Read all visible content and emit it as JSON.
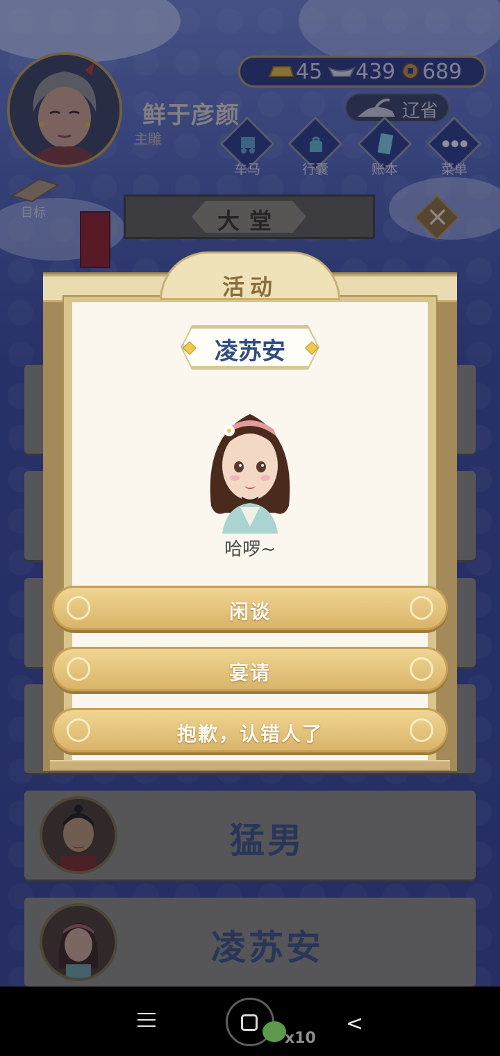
{
  "player": {
    "name": "鲜于彦颜",
    "title": "主雕"
  },
  "currencies": [
    {
      "icon": "gold-bar-icon",
      "value": "45"
    },
    {
      "icon": "silver-ingot-icon",
      "value": "439"
    },
    {
      "icon": "copper-coin-icon",
      "value": "689"
    }
  ],
  "region": {
    "label": "辽省",
    "icon": "iron-icon"
  },
  "menu": [
    {
      "label": "车马",
      "icon": "carriage-icon"
    },
    {
      "label": "行囊",
      "icon": "bag-icon"
    },
    {
      "label": "账本",
      "icon": "ledger-icon"
    },
    {
      "label": "菜单",
      "icon": "more-icon"
    }
  ],
  "goal": {
    "label": "目标",
    "icon": "scroll-icon"
  },
  "location": {
    "label": "大堂"
  },
  "list": [
    {
      "name": "猛男"
    },
    {
      "name": "凌苏安"
    }
  ],
  "dialog": {
    "title": "活动",
    "npc_name": "凌苏安",
    "greeting": "哈啰~",
    "options": [
      {
        "label": "闲谈"
      },
      {
        "label": "宴请"
      },
      {
        "label": "抱歉，认错人了"
      }
    ]
  },
  "system": {
    "badge": "x10"
  },
  "colors": {
    "accent_gold": "#d9b46a",
    "npc_name_blue": "#2e4d82",
    "background_blue": "#3d4a93"
  }
}
